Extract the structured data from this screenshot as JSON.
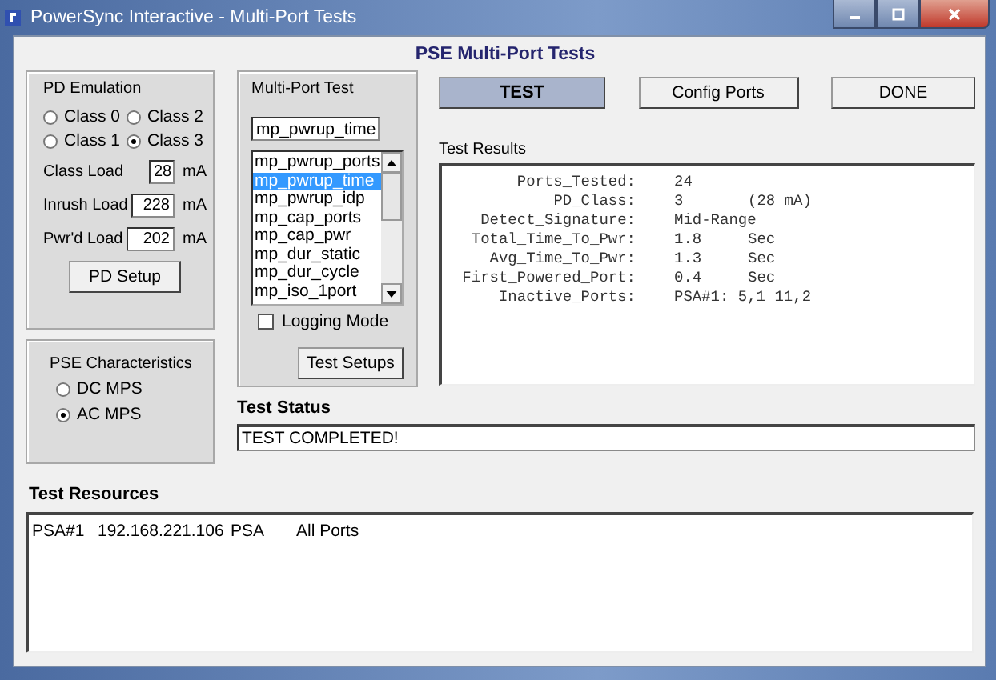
{
  "window": {
    "title": "PowerSync Interactive - Multi-Port Tests"
  },
  "heading": "PSE Multi-Port Tests",
  "pd_emulation": {
    "title": "PD Emulation",
    "classes": [
      {
        "label": "Class 0",
        "selected": false
      },
      {
        "label": "Class 2",
        "selected": false
      },
      {
        "label": "Class 1",
        "selected": false
      },
      {
        "label": "Class 3",
        "selected": true
      }
    ],
    "loads": [
      {
        "label": "Class Load",
        "value": "28",
        "unit": "mA"
      },
      {
        "label": "Inrush Load",
        "value": "228",
        "unit": "mA"
      },
      {
        "label": "Pwr'd Load",
        "value": "202",
        "unit": "mA"
      }
    ],
    "button": "PD Setup"
  },
  "pse_characteristics": {
    "title": "PSE Characteristics",
    "options": [
      {
        "label": "DC MPS",
        "selected": false
      },
      {
        "label": "AC MPS",
        "selected": true
      }
    ]
  },
  "multi_port_test": {
    "title": "Multi-Port Test",
    "value": "mp_pwrup_time",
    "items": [
      {
        "label": "mp_pwrup_ports",
        "selected": false
      },
      {
        "label": "mp_pwrup_time",
        "selected": true
      },
      {
        "label": "mp_pwrup_idp",
        "selected": false
      },
      {
        "label": "mp_cap_ports",
        "selected": false
      },
      {
        "label": "mp_cap_pwr",
        "selected": false
      },
      {
        "label": "mp_dur_static",
        "selected": false
      },
      {
        "label": "mp_dur_cycle",
        "selected": false
      },
      {
        "label": "mp_iso_1port",
        "selected": false
      }
    ],
    "logging_mode": {
      "label": "Logging Mode",
      "checked": false
    },
    "button": "Test Setups"
  },
  "buttons": [
    {
      "label": "TEST",
      "selected": true
    },
    {
      "label": "Config Ports",
      "selected": false
    },
    {
      "label": "DONE",
      "selected": false
    }
  ],
  "test_results": {
    "title": "Test Results",
    "rows": [
      {
        "label": "Ports_Tested:",
        "value": "24"
      },
      {
        "label": "PD_Class:",
        "value": "3",
        "unit": "(28 mA)"
      },
      {
        "label": "Detect_Signature:",
        "value": "Mid-Range"
      },
      {
        "label": "Total_Time_To_Pwr:",
        "value": "1.8",
        "unit": "Sec"
      },
      {
        "label": "Avg_Time_To_Pwr:",
        "value": "1.3",
        "unit": "Sec"
      },
      {
        "label": "First_Powered_Port:",
        "value": "0.4",
        "unit": "Sec"
      },
      {
        "label": "Inactive_Ports:",
        "value": "PSA#1: 5,1 11,2"
      }
    ]
  },
  "test_status": {
    "title": "Test Status",
    "value": "TEST COMPLETED!"
  },
  "test_resources": {
    "title": "Test Resources",
    "rows": [
      [
        "PSA#1",
        "192.168.221.106",
        "PSA",
        "All Ports"
      ]
    ]
  }
}
